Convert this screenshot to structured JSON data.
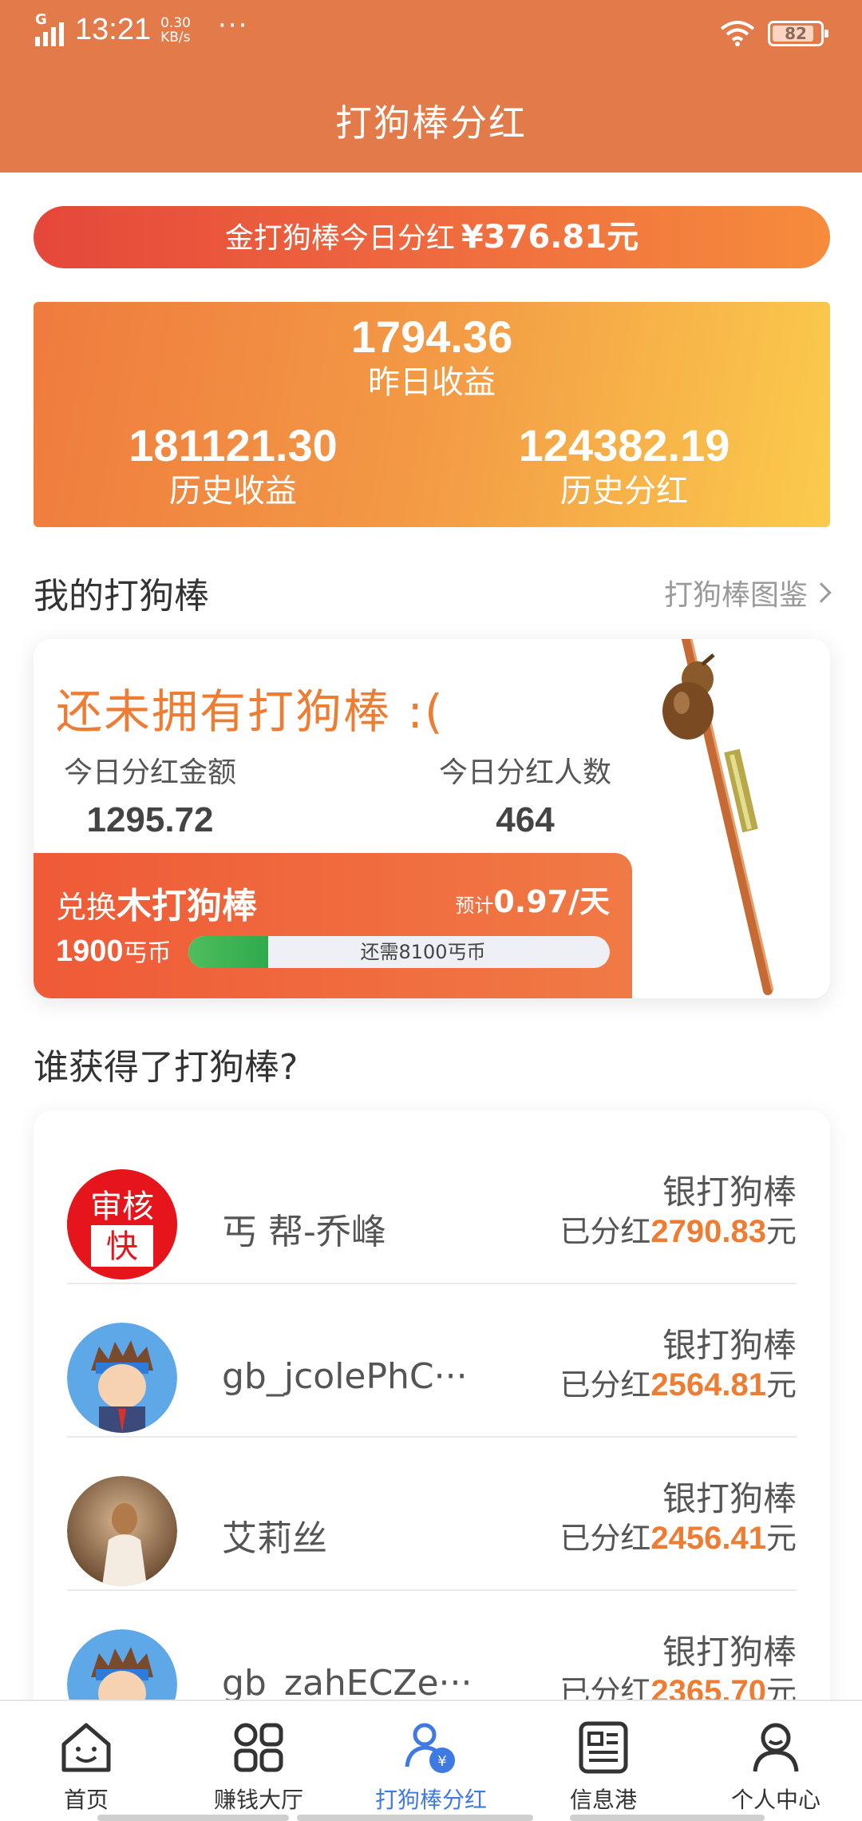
{
  "status_bar": {
    "network": "G",
    "time": "13:21",
    "speed_value": "0.30",
    "speed_unit": "KB/s",
    "more": "···",
    "battery": "82"
  },
  "header": {
    "title": "打狗棒分红"
  },
  "gold_banner": {
    "label": "金打狗棒今日分红",
    "amount": "¥376.81元"
  },
  "stats": {
    "yesterday": {
      "value": "1794.36",
      "label": "昨日收益"
    },
    "history_earnings": {
      "value": "181121.30",
      "label": "历史收益"
    },
    "history_dividends": {
      "value": "124382.19",
      "label": "历史分红"
    }
  },
  "my_sticks": {
    "title": "我的打狗棒",
    "guide_link": "打狗棒图鉴",
    "empty_text": "还未拥有打狗棒 :(",
    "today_amount_label": "今日分红金额",
    "today_amount": "1295.72",
    "today_people_label": "今日分红人数",
    "today_people": "464",
    "exchange": {
      "prefix": "兑换",
      "item": "木打狗棒",
      "estimate_prefix": "预计",
      "estimate_value": "0.97/天",
      "price": "1900",
      "price_unit": "丐币",
      "remaining": "还需8100丐币",
      "progress_fraction": 0.19
    }
  },
  "winners": {
    "title": "谁获得了打狗棒?",
    "items": [
      {
        "name": "丐 帮-乔峰",
        "rank": "银打狗棒",
        "prefix": "已分红",
        "amount": "2790.83",
        "unit": "元",
        "avatar_text_top": "审核",
        "avatar_text_bottom": "快"
      },
      {
        "name": "gb_jcolePhC···",
        "rank": "银打狗棒",
        "prefix": "已分红",
        "amount": "2564.81",
        "unit": "元"
      },
      {
        "name": "艾莉丝",
        "rank": "银打狗棒",
        "prefix": "已分红",
        "amount": "2456.41",
        "unit": "元"
      },
      {
        "name": "gb_zahECZe···",
        "rank": "银打狗棒",
        "prefix": "已分红",
        "amount": "2365.70",
        "unit": "元"
      }
    ]
  },
  "tabbar": {
    "items": [
      {
        "label": "首页",
        "icon": "home-icon"
      },
      {
        "label": "赚钱大厅",
        "icon": "grid-icon"
      },
      {
        "label": "打狗棒分红",
        "icon": "dividend-icon"
      },
      {
        "label": "信息港",
        "icon": "news-icon"
      },
      {
        "label": "个人中心",
        "icon": "user-icon"
      }
    ],
    "active_index": 2
  },
  "colors": {
    "header": "#e27a4a",
    "accent_orange": "#ef7c33",
    "active_tab": "#3f79e4",
    "progress_green": "#3cb553"
  }
}
